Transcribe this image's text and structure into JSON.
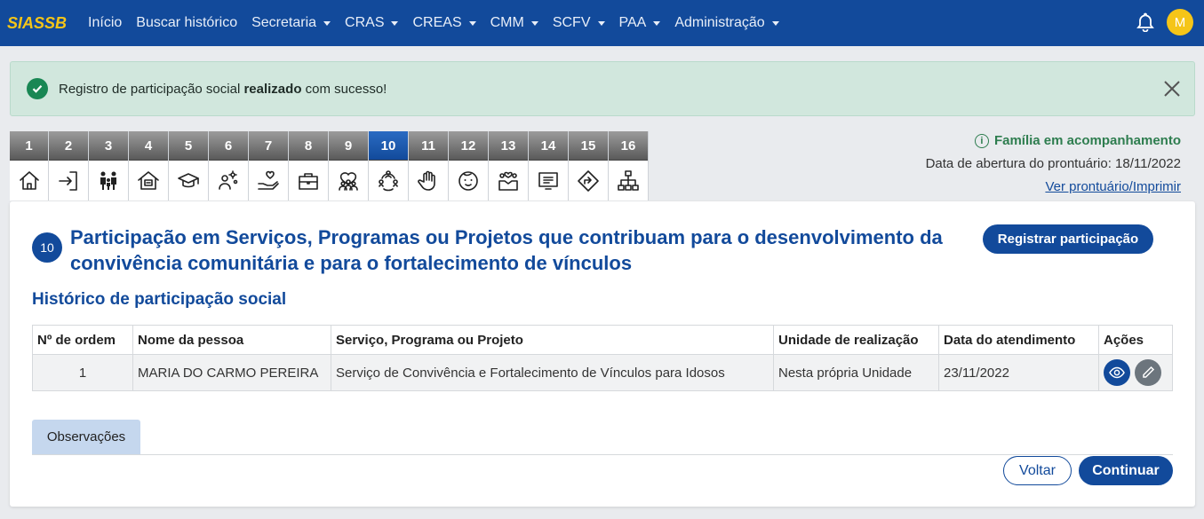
{
  "nav": {
    "brand": "SIASSB",
    "items": [
      {
        "label": "Início",
        "dropdown": false
      },
      {
        "label": "Buscar histórico",
        "dropdown": false
      },
      {
        "label": "Secretaria",
        "dropdown": true
      },
      {
        "label": "CRAS",
        "dropdown": true
      },
      {
        "label": "CREAS",
        "dropdown": true
      },
      {
        "label": "CMM",
        "dropdown": true
      },
      {
        "label": "SCFV",
        "dropdown": true
      },
      {
        "label": "PAA",
        "dropdown": true
      },
      {
        "label": "Administração",
        "dropdown": true
      }
    ],
    "bell_icon": "bell-icon",
    "avatar_initial": "M"
  },
  "alert": {
    "prefix": "Registro de participação social ",
    "bold": "realizado",
    "suffix": " com sucesso!",
    "icon": "check-circle-icon",
    "close_icon": "close-icon"
  },
  "tabs": [
    {
      "num": "1",
      "icon": "home-icon"
    },
    {
      "num": "2",
      "icon": "login-icon"
    },
    {
      "num": "3",
      "icon": "family-icon"
    },
    {
      "num": "4",
      "icon": "housing-icon"
    },
    {
      "num": "5",
      "icon": "graduation-cap-icon"
    },
    {
      "num": "6",
      "icon": "work-icon"
    },
    {
      "num": "7",
      "icon": "hand-heart-icon"
    },
    {
      "num": "8",
      "icon": "briefcase-icon"
    },
    {
      "num": "9",
      "icon": "group-heart-icon"
    },
    {
      "num": "10",
      "icon": "community-icon",
      "active": true
    },
    {
      "num": "11",
      "icon": "stop-hand-icon"
    },
    {
      "num": "12",
      "icon": "child-face-icon"
    },
    {
      "num": "13",
      "icon": "people-heart-icon"
    },
    {
      "num": "14",
      "icon": "screen-icon"
    },
    {
      "num": "15",
      "icon": "direction-sign-icon"
    },
    {
      "num": "16",
      "icon": "hierarchy-icon"
    }
  ],
  "info": {
    "status": "Família em acompanhamento",
    "opening_date": "Data de abertura do prontuário: 18/11/2022",
    "print_link": "Ver prontuário/Imprimir"
  },
  "card": {
    "badge": "10",
    "title": "Participação em Serviços, Programas ou Projetos que contribuam para o desenvolvimento da convivência comunitária e para o fortalecimento de vínculos",
    "register_button": "Registrar participação",
    "section_title": "Histórico de participação social",
    "table": {
      "headers": [
        "Nº de ordem",
        "Nome da pessoa",
        "Serviço, Programa ou Projeto",
        "Unidade de realização",
        "Data do atendimento",
        "Ações"
      ],
      "rows": [
        {
          "order": "1",
          "name": "MARIA DO CARMO PEREIRA",
          "service": "Serviço de Convivência e Fortalecimento de Vínculos para Idosos",
          "unit": "Nesta própria Unidade",
          "date": "23/11/2022"
        }
      ]
    },
    "obs_tab": "Observações",
    "back_button": "Voltar",
    "continue_button": "Continuar"
  }
}
